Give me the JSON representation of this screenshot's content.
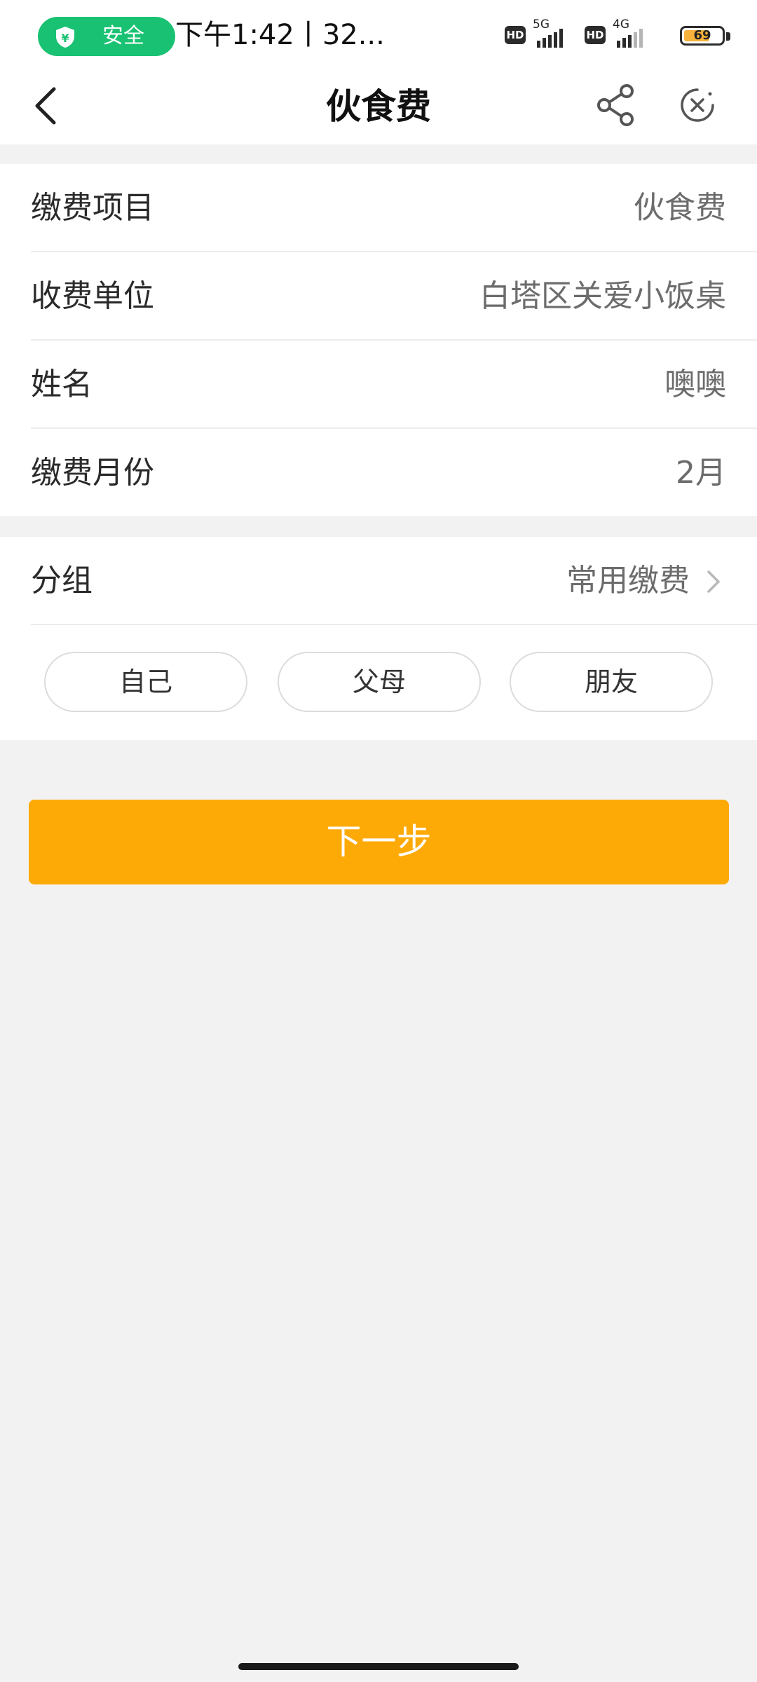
{
  "status_bar": {
    "safe_label": "安全",
    "time": "下午1:42丨32...",
    "hd_badge_1": "HD",
    "network_1": "5G",
    "hd_badge_2": "HD",
    "network_2": "4G",
    "battery": "69",
    "battery_level": 0.69,
    "safe_color": "#19c172"
  },
  "nav": {
    "title": "伙食费",
    "icons": [
      "back-arrow-icon",
      "share-icon",
      "close-circle-icon"
    ]
  },
  "form": {
    "rows": [
      {
        "label": "缴费项目",
        "value": "伙食费"
      },
      {
        "label": "收费单位",
        "value": "白塔区关爱小饭桌"
      },
      {
        "label": "姓名",
        "value": "噢噢"
      },
      {
        "label": "缴费月份",
        "value": "2月"
      }
    ]
  },
  "group": {
    "label": "分组",
    "value": "常用缴费",
    "chips": [
      "自己",
      "父母",
      "朋友"
    ]
  },
  "next_button": {
    "label": "下一步",
    "color": "#fdaa07"
  }
}
